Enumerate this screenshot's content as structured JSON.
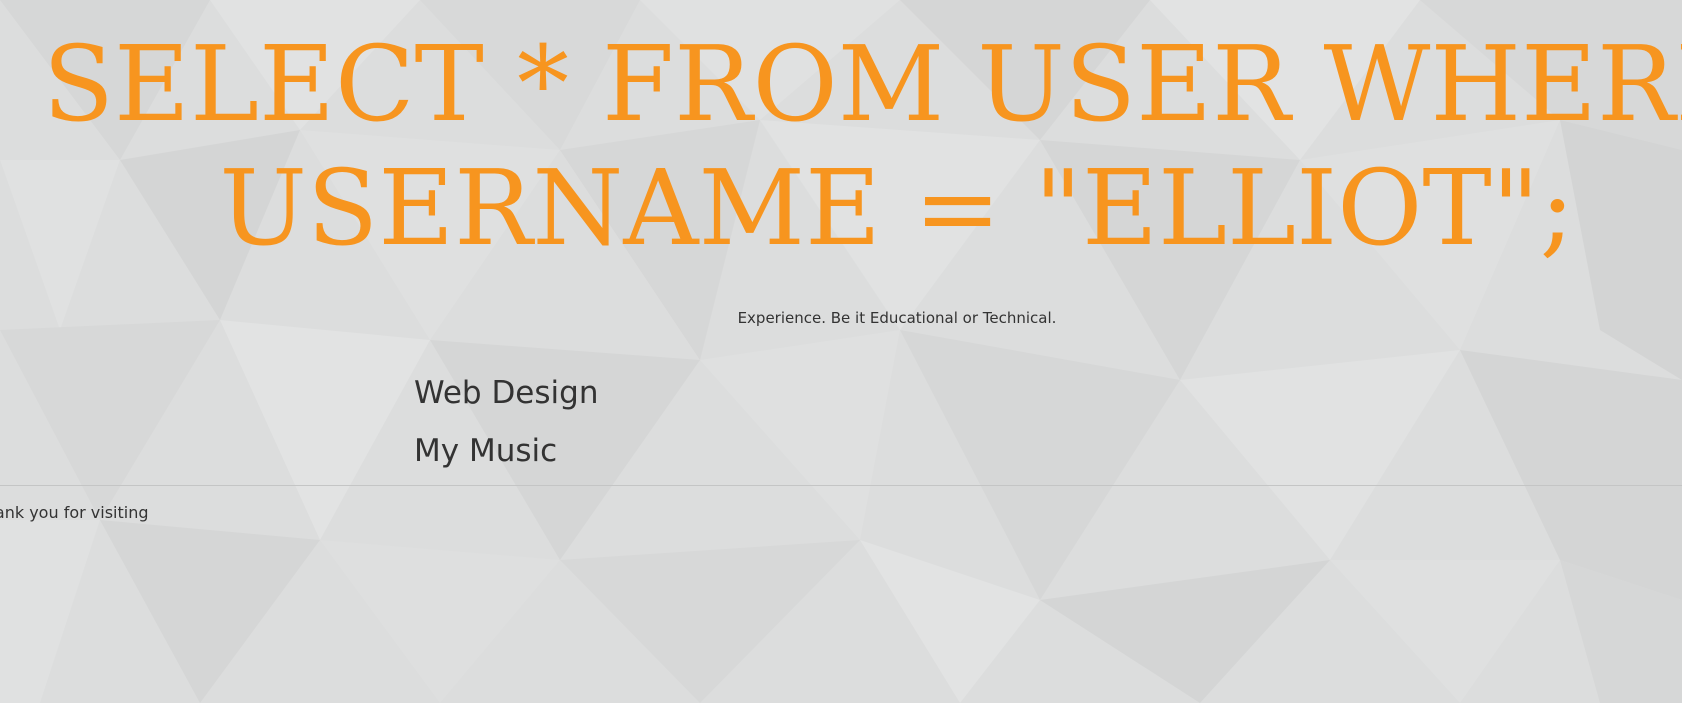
{
  "colors": {
    "background": "#dcdddd",
    "accent": "#f7951f",
    "text": "#333333",
    "divider": "#c4c5c5"
  },
  "hero": {
    "title_line1": "SELECT * FROM USER WHERE",
    "title_line2": "USERNAME = \"ELLIOT\";"
  },
  "tagline": "Experience. Be it Educational or Technical.",
  "nav": {
    "items": [
      {
        "label": "Web Design"
      },
      {
        "label": "My Music"
      }
    ]
  },
  "footer": {
    "text": "Thank you for visiting"
  }
}
